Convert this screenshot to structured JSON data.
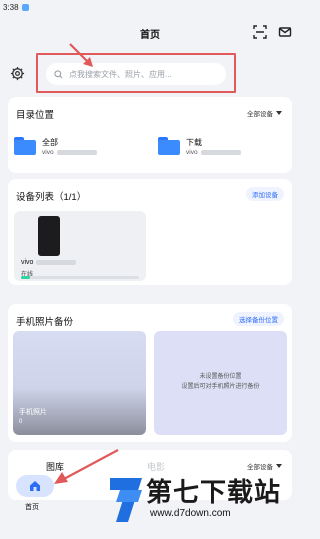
{
  "status_bar": {
    "time": "3:38"
  },
  "header": {
    "title": "首页"
  },
  "search": {
    "placeholder": "点我搜索文件、照片、应用..."
  },
  "directory": {
    "title": "目录位置",
    "filter_label": "全部设备",
    "items": [
      {
        "name": "全部",
        "device": "vivo"
      },
      {
        "name": "下载",
        "device": "vivo"
      }
    ]
  },
  "devices": {
    "title": "设备列表（1/1）",
    "add_label": "添加设备",
    "items": [
      {
        "name": "vivo",
        "status": "在线",
        "storage_used_fraction": 0.08
      }
    ]
  },
  "backup": {
    "title": "手机照片备份",
    "select_label": "选择备份位置",
    "left_tile": {
      "title": "手机照片",
      "count": "0"
    },
    "right_tile": {
      "line1": "未设置备份位置",
      "line2": "设置后可对手机照片进行备份"
    }
  },
  "gallery": {
    "tabs": [
      {
        "label": "图库"
      },
      {
        "label": "电影"
      }
    ],
    "filter_label": "全部设备"
  },
  "bottom_nav": {
    "home_label": "首页"
  },
  "watermark": {
    "title": "第七下载站",
    "url": "www.d7down.com"
  },
  "colors": {
    "accent": "#2f6cf5",
    "highlight_box": "#e05a5a",
    "status_green": "#2fd3a0"
  }
}
